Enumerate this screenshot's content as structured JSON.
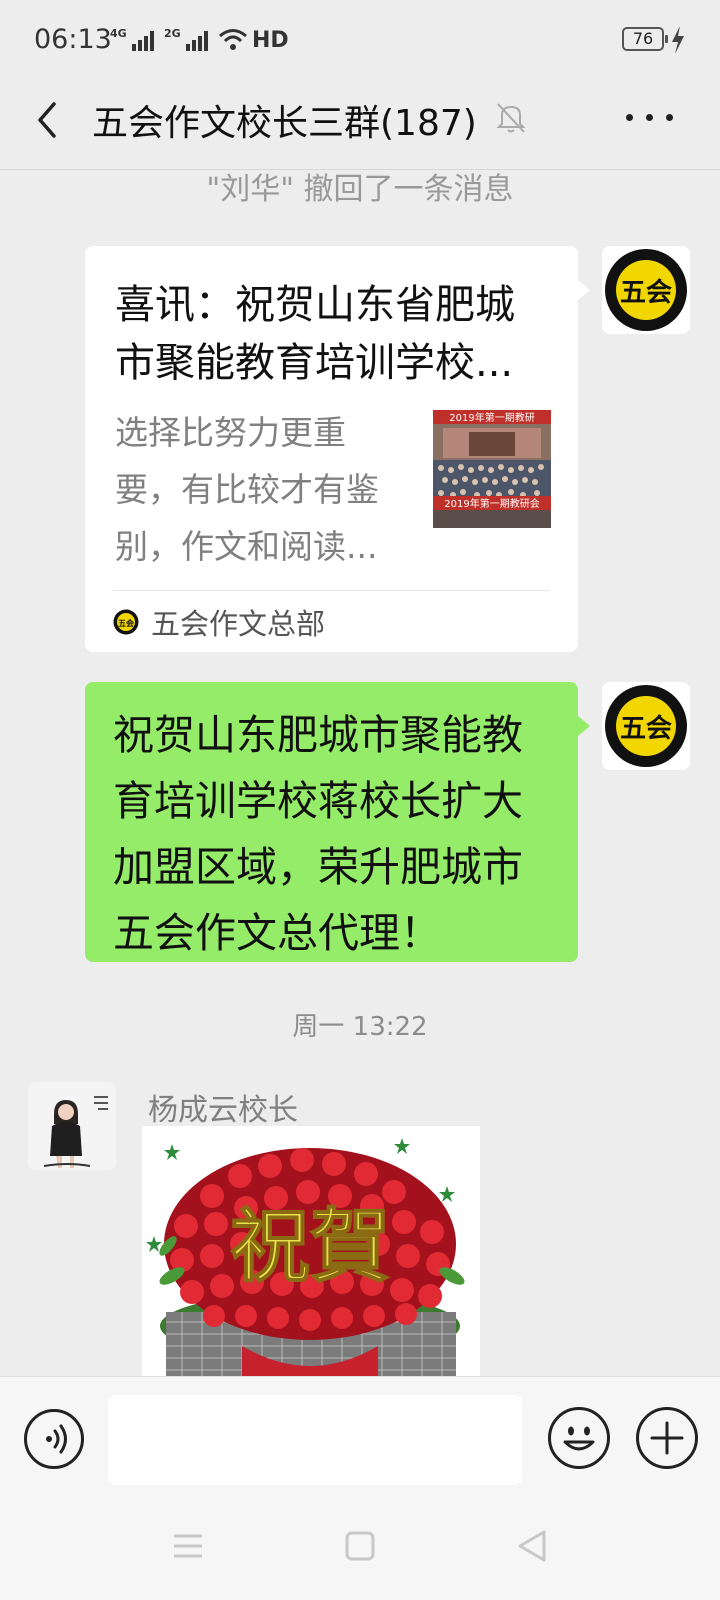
{
  "status": {
    "time": "06:13",
    "net1": "4G",
    "net2": "2G",
    "hd": "HD",
    "battery": "76"
  },
  "header": {
    "title": "五会作文校长三群(187)"
  },
  "messages": {
    "recall_note": "\"刘华\" 撤回了一条消息",
    "card": {
      "title_line1": "喜讯：祝贺山东省肥城",
      "title_line2": "市聚能教育培训学校...",
      "desc_line1": "选择比努力更重",
      "desc_line2": "要，有比较才有鉴",
      "desc_line3": "别，作文和阅读...",
      "thumb_caption_top": "2019年第一期教研",
      "thumb_caption_bottom": "2019年第一期教研会",
      "source": "五会作文总部"
    },
    "text_bubble": "祝贺山东肥城市聚能教育培训学校蒋校长扩大加盟区域，荣升肥城市五会作文总代理！",
    "timestamp": "周一 13:22",
    "incoming": {
      "sender": "杨成云校长",
      "image_text": "祝賀"
    },
    "logo_text": "五会"
  },
  "input": {
    "placeholder": ""
  },
  "icons": {
    "back": "back-arrow-icon",
    "mute": "bell-muted-icon",
    "more": "more-icon",
    "voice": "voice-icon",
    "emoji": "emoji-icon",
    "plus": "plus-icon"
  },
  "colors": {
    "bubble_sent": "#95ec69",
    "background": "#ededed"
  }
}
